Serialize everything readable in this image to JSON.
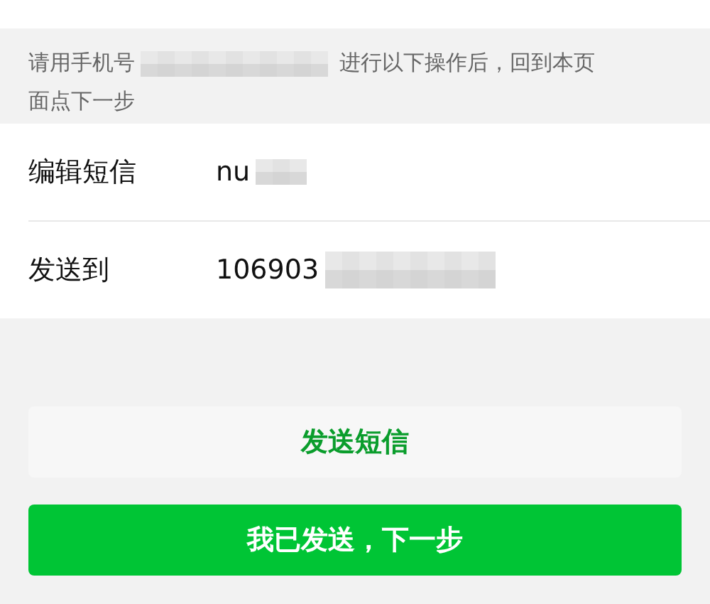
{
  "instruction": {
    "before": "请用手机号",
    "after": "进行以下操作后，回到本页",
    "continuation": "面点下一步"
  },
  "rows": [
    {
      "label": "编辑短信",
      "value": "nu"
    },
    {
      "label": "发送到",
      "value": "106903"
    }
  ],
  "buttons": [
    {
      "label": "发送短信",
      "kind": "secondary"
    },
    {
      "label": "我已发送，下一步",
      "kind": "primary"
    }
  ]
}
